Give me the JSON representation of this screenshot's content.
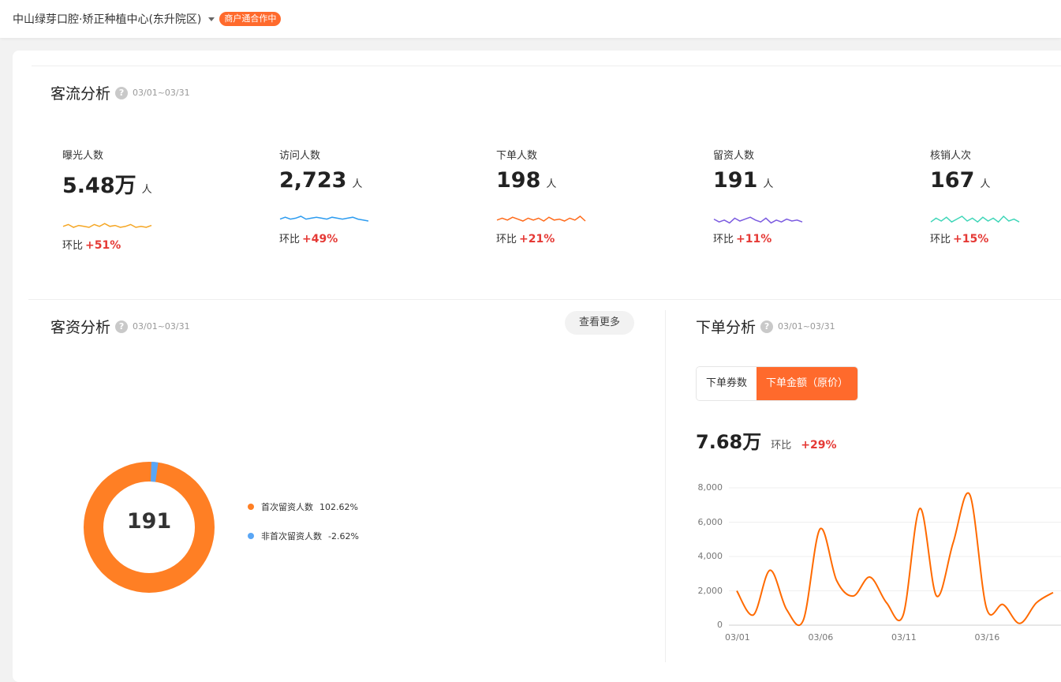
{
  "header": {
    "store_name": "中山绿芽口腔·矫正种植中心(东升院区)",
    "status_badge": "商户通合作中"
  },
  "traffic": {
    "title": "客流分析",
    "help": "?",
    "date_range": "03/01~03/31",
    "compare_label": "环比",
    "metrics": [
      {
        "label": "曝光人数",
        "value": "5.48万",
        "unit": "人",
        "change": "+51%",
        "color": "#f5a623"
      },
      {
        "label": "访问人数",
        "value": "2,723",
        "unit": "人",
        "change": "+49%",
        "color": "#2d9cf0"
      },
      {
        "label": "下单人数",
        "value": "198",
        "unit": "人",
        "change": "+21%",
        "color": "#ff6a1a"
      },
      {
        "label": "留资人数",
        "value": "191",
        "unit": "人",
        "change": "+11%",
        "color": "#7b5be0"
      },
      {
        "label": "核销人次",
        "value": "167",
        "unit": "人",
        "change": "+15%",
        "color": "#3fd6b8"
      }
    ]
  },
  "leads": {
    "title": "客资分析",
    "help": "?",
    "date_range": "03/01~03/31",
    "more_button": "查看更多",
    "total": "191",
    "legend": [
      {
        "label": "首次留资人数",
        "pct": "102.62%",
        "color": "#ff7f24"
      },
      {
        "label": "非首次留资人数",
        "pct": "-2.62%",
        "color": "#5aa6f5"
      }
    ]
  },
  "orders": {
    "title": "下单分析",
    "help": "?",
    "date_range": "03/01~03/31",
    "tabs": [
      {
        "label": "下单券数",
        "active": false
      },
      {
        "label": "下单金额（原价）",
        "active": true
      }
    ],
    "total": "7.68万",
    "compare_label": "环比",
    "change": "+29%"
  },
  "chart_data": {
    "type": "line",
    "title": "",
    "xlabel": "",
    "ylabel": "",
    "color": "#ff6a00",
    "ylim": [
      0,
      8000
    ],
    "y_ticks": [
      "8,000",
      "6,000",
      "4,000",
      "2,000",
      "0"
    ],
    "x_ticks": [
      "03/01",
      "03/06",
      "03/11",
      "03/16"
    ],
    "x": [
      "03/01",
      "03/02",
      "03/03",
      "03/04",
      "03/05",
      "03/06",
      "03/07",
      "03/08",
      "03/09",
      "03/10",
      "03/11",
      "03/12",
      "03/13",
      "03/14",
      "03/15",
      "03/16",
      "03/17",
      "03/18",
      "03/19",
      "03/20"
    ],
    "series": [
      {
        "values": [
          2000,
          600,
          3200,
          900,
          300,
          5600,
          2600,
          1700,
          2800,
          1300,
          600,
          6800,
          1700,
          4800,
          7600,
          1000,
          1200,
          100,
          1300,
          1900
        ]
      }
    ]
  }
}
